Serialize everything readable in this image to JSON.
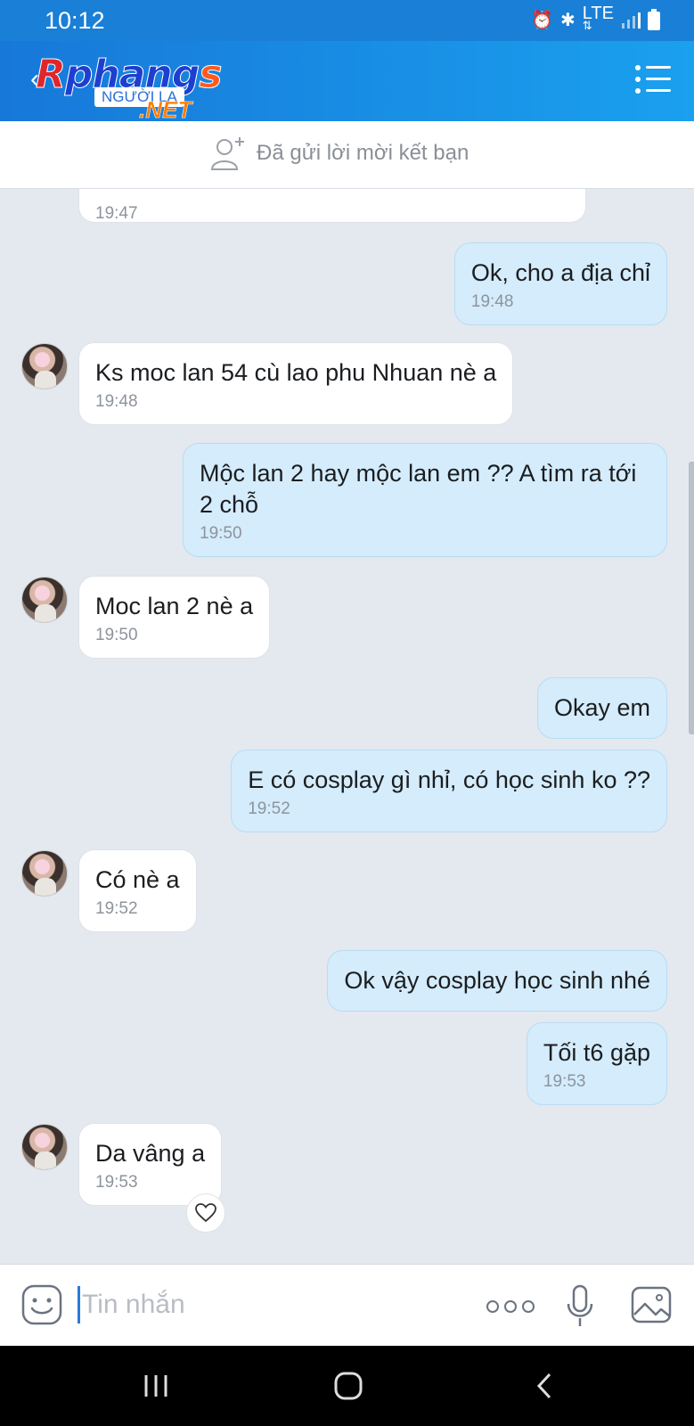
{
  "status_bar": {
    "time": "10:12",
    "network": "LTE",
    "icons": [
      "alarm-icon",
      "bluetooth-icon",
      "lte-icon",
      "signal-icon",
      "battery-icon"
    ]
  },
  "app_bar": {
    "logo": {
      "main_r": "R",
      "main": "phang",
      "main_s": "s",
      "sub": "NGƯỜI LẠ",
      "net": ".NET"
    },
    "back_icon": "back-arrow-icon",
    "menu_icon": "menu-list-icon"
  },
  "friend_request": {
    "text": "Đã gửi lời mời kết bạn",
    "icon": "add-friend-icon"
  },
  "messages": [
    {
      "side": "in",
      "text": "",
      "time": "19:47",
      "avatar": false
    },
    {
      "side": "out",
      "text": "Ok, cho a địa chỉ",
      "time": "19:48"
    },
    {
      "side": "in",
      "text": "Ks moc lan 54 cù lao phu Nhuan nè a",
      "time": "19:48",
      "avatar": true
    },
    {
      "side": "out",
      "text": "Mộc lan 2 hay mộc lan em ?? A tìm ra tới 2 chỗ",
      "time": "19:50"
    },
    {
      "side": "in",
      "text": "Moc lan 2 nè a",
      "time": "19:50",
      "avatar": true
    },
    {
      "side": "out",
      "text": "Okay em",
      "time": ""
    },
    {
      "side": "out",
      "text": "E có cosplay gì nhỉ, có học sinh ko ??",
      "time": "19:52"
    },
    {
      "side": "in",
      "text": "Có nè a",
      "time": "19:52",
      "avatar": true
    },
    {
      "side": "out",
      "text": "Ok vậy cosplay học sinh nhé",
      "time": ""
    },
    {
      "side": "out",
      "text": "Tối t6 gặp",
      "time": "19:53"
    },
    {
      "side": "in",
      "text": "Da vâng a",
      "time": "19:53",
      "avatar": true,
      "reaction": "heart-icon"
    }
  ],
  "composer": {
    "placeholder": "Tin nhắn",
    "value": "",
    "icons": [
      "emoji-icon",
      "more-icon",
      "microphone-icon",
      "image-icon"
    ]
  },
  "nav_bar": {
    "icons": [
      "recent-apps-icon",
      "home-icon",
      "back-icon"
    ]
  },
  "colors": {
    "app_bar": "#1a8ae3",
    "incoming_bubble": "#ffffff",
    "outgoing_bubble": "#d4ecfb",
    "chat_background": "#e4e8ef"
  }
}
